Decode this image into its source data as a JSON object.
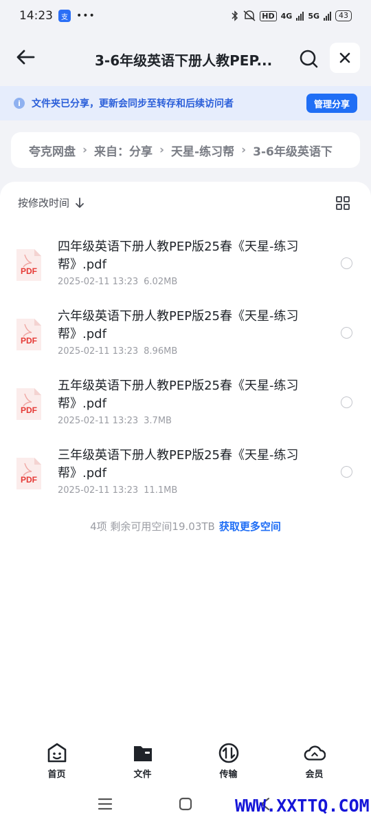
{
  "status_bar": {
    "time": "14:23",
    "app_badge": "支",
    "dots": "•••",
    "hd_label": "HD",
    "net1": "4G",
    "net2": "5G",
    "battery": "43"
  },
  "header": {
    "title": "3-6年级英语下册人教PEP..."
  },
  "banner": {
    "text": "文件夹已分享，更新会同步至转存和后续访问者",
    "button": "管理分享"
  },
  "breadcrumb": [
    "夸克网盘",
    "来自：分享",
    "天星-练习帮",
    "3-6年级英语下"
  ],
  "sort": {
    "label": "按修改时间"
  },
  "files": [
    {
      "name": "四年级英语下册人教PEP版25春《天星-练习帮》.pdf",
      "date": "2025-02-11 13:23",
      "size": "6.02MB",
      "icon_label": "PDF"
    },
    {
      "name": "六年级英语下册人教PEP版25春《天星-练习帮》.pdf",
      "date": "2025-02-11 13:23",
      "size": "8.96MB",
      "icon_label": "PDF"
    },
    {
      "name": "五年级英语下册人教PEP版25春《天星-练习帮》.pdf",
      "date": "2025-02-11 13:23",
      "size": "3.7MB",
      "icon_label": "PDF"
    },
    {
      "name": "三年级英语下册人教PEP版25春《天星-练习帮》.pdf",
      "date": "2025-02-11 13:23",
      "size": "11.1MB",
      "icon_label": "PDF"
    }
  ],
  "footer": {
    "summary": "4项 剩余可用空间19.03TB",
    "link": "获取更多空间"
  },
  "bottom_nav": [
    {
      "label": "首页",
      "icon": "home-face-icon"
    },
    {
      "label": "文件",
      "icon": "folder-icon"
    },
    {
      "label": "传输",
      "icon": "transfer-icon"
    },
    {
      "label": "会员",
      "icon": "cloud-member-icon"
    }
  ],
  "watermark": "WWW.XXTTQ.COM",
  "colors": {
    "accent": "#1f6ef5",
    "banner_bg": "#e6edfc",
    "pdf_red": "#e53935"
  }
}
